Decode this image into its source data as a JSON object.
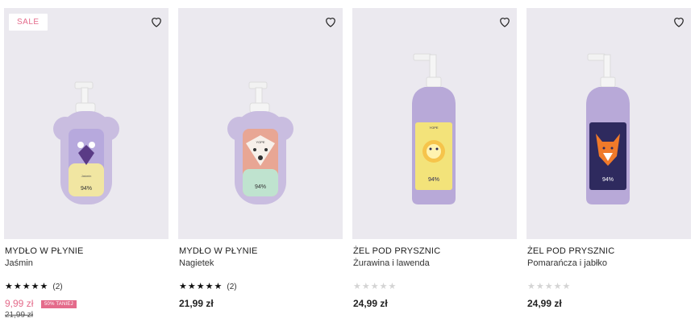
{
  "products": [
    {
      "badge": "SALE",
      "category": "MYDŁO W PŁYNIE",
      "name": "Jaśmin",
      "rating_stars": 5,
      "rating_count": "(2)",
      "price": "9,99 zł",
      "price_label": "50% TANIEJ",
      "old_price": "21,99 zł",
      "bottle_type": "bear-soap",
      "colors": {
        "bottle": "#c9bde0",
        "label_top": "#b7a9dd",
        "label_bottom": "#f1e6a2",
        "accent": "#5a3b86"
      }
    },
    {
      "category": "MYDŁO W PŁYNIE",
      "name": "Nagietek",
      "rating_stars": 5,
      "rating_count": "(2)",
      "price": "21,99 zł",
      "bottle_type": "bear-soap",
      "colors": {
        "bottle": "#c9bde0",
        "label_top": "#e8a694",
        "label_bottom": "#bfe3cf",
        "accent": "#d9725b"
      }
    },
    {
      "category": "ŻEL POD PRYSZNIC",
      "name": "Żurawina i lawenda",
      "rating_stars": 0,
      "price": "24,99 zł",
      "bottle_type": "shower-gel",
      "colors": {
        "bottle": "#b8a9d8",
        "label_top": "#f3e37a",
        "label_bottom": "#f3e37a",
        "accent": "#2d2a55"
      }
    },
    {
      "category": "ŻEL POD PRYSZNIC",
      "name": "Pomarańcza i jabłko",
      "rating_stars": 0,
      "price": "24,99 zł",
      "bottle_type": "shower-gel",
      "colors": {
        "bottle": "#b8a9d8",
        "label_top": "#2e2a5e",
        "label_bottom": "#2e2a5e",
        "accent": "#f07a2a"
      }
    }
  ],
  "bottle_text": {
    "brand": "YOPE",
    "percent": "94%"
  },
  "icons": {
    "favorite": "heart-outline-icon",
    "star": "star-icon"
  }
}
